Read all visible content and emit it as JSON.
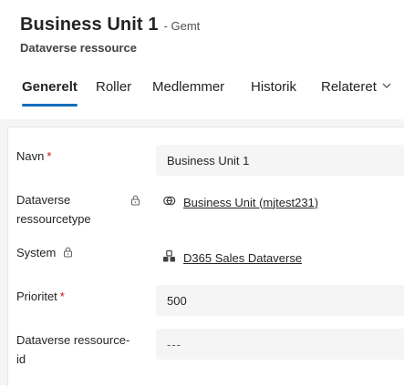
{
  "header": {
    "title": "Business Unit 1",
    "status": "- Gemt",
    "subtitle": "Dataverse ressource"
  },
  "tabs": [
    {
      "label": "Generelt",
      "active": true
    },
    {
      "label": "Roller",
      "active": false
    },
    {
      "label": "Medlemmer",
      "active": false
    },
    {
      "label": "Historik",
      "active": false
    },
    {
      "label": "Relateret",
      "active": false
    }
  ],
  "form": {
    "name": {
      "label": "Navn",
      "required": "*",
      "value": "Business Unit 1"
    },
    "resource_type": {
      "label_line1": "Dataverse",
      "label_line2": "ressourcetype",
      "value": "Business Unit (mjtest231)",
      "icon": "link-resource-icon"
    },
    "system": {
      "label": "System",
      "value": "D365 Sales Dataverse",
      "icon": "system-icon"
    },
    "priority": {
      "label": "Prioritet",
      "required": "*",
      "value": "500"
    },
    "resource_id": {
      "label_line1": "Dataverse ressource-",
      "label_line2": "id",
      "placeholder": "---"
    }
  },
  "colors": {
    "accent": "#0f6cbd",
    "required": "#c50f1f",
    "field_bg": "#f5f5f5"
  }
}
